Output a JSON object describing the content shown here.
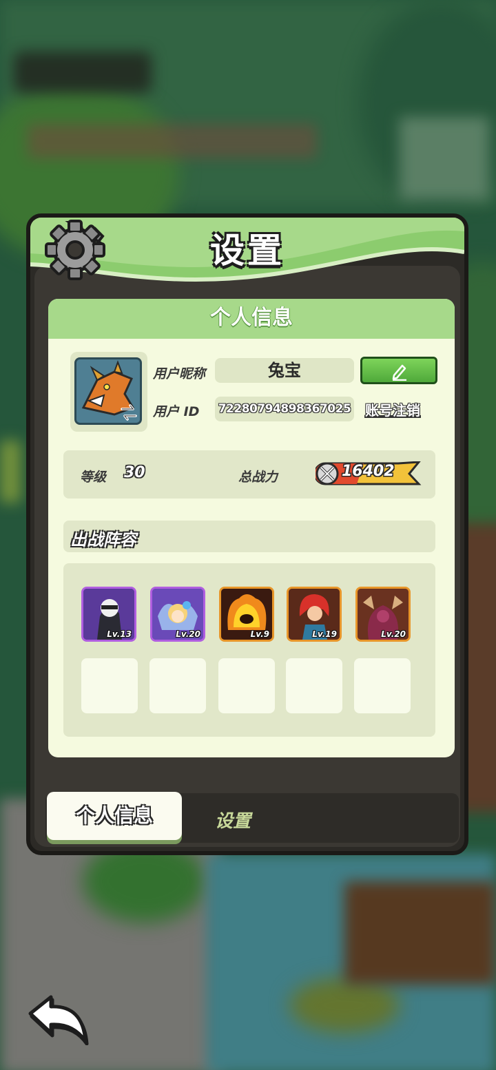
{
  "title": "设置",
  "card": {
    "header": "个人信息",
    "nickname_label": "用户昵称",
    "nickname_value": "兔宝",
    "user_id_label": "用户 ID",
    "user_id_value": "72280794898367025",
    "delete_account_label": "账号注销",
    "level_label": "等级",
    "level_value": "30",
    "power_label": "总战力",
    "power_value": "16402",
    "lineup_title": "出战阵容",
    "heroes": [
      {
        "level": "Lv.13",
        "frame": "purple"
      },
      {
        "level": "Lv.20",
        "frame": "purple"
      },
      {
        "level": "Lv.9",
        "frame": "orange"
      },
      {
        "level": "Lv.19",
        "frame": "orange"
      },
      {
        "level": "Lv.20",
        "frame": "orange"
      }
    ]
  },
  "tabs": {
    "profile": "个人信息",
    "settings": "设置"
  },
  "icons": {
    "gear": "gear-icon",
    "edit": "pencil-icon",
    "swap": "swap-icon",
    "power": "crossed-swords-icon",
    "back": "back-arrow-icon"
  },
  "colors": {
    "header_green": "#a7d98a",
    "card_bg": "#f5fadf",
    "edit_button": "#5fbf45",
    "purple_frame": "#b05ee0",
    "orange_frame": "#e8962a"
  }
}
